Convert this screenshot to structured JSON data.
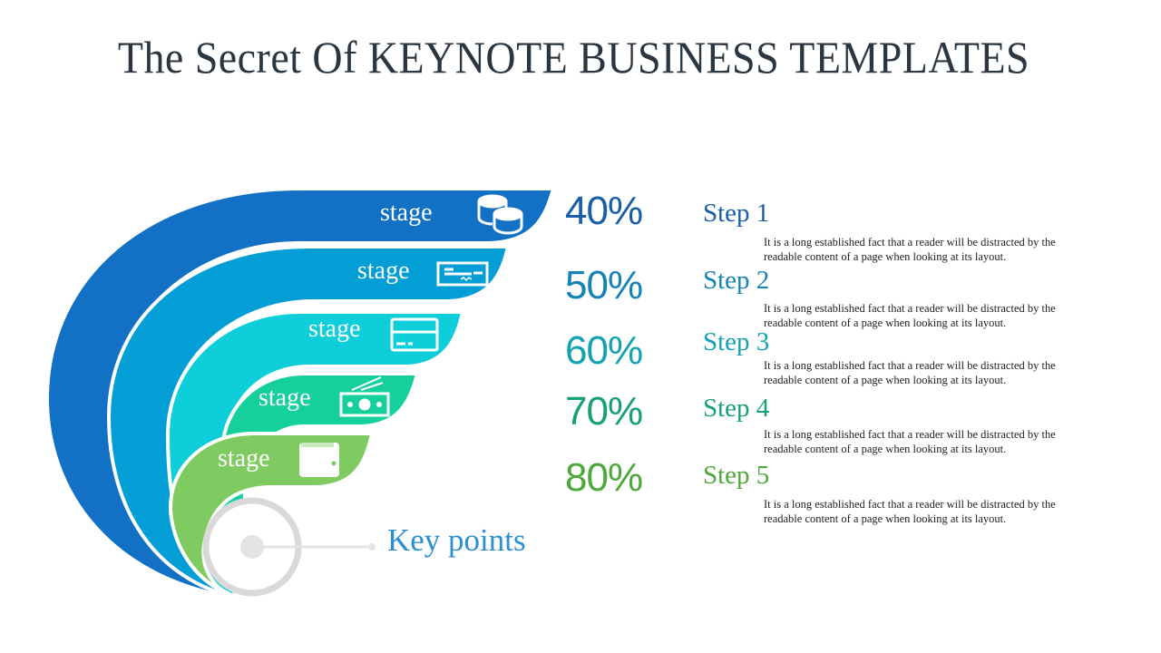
{
  "title": "The Secret Of KEYNOTE BUSINESS TEMPLATES",
  "stages": [
    {
      "label": "stage",
      "icon": "coins-icon",
      "percent": "40%",
      "step": "Step 1",
      "color": "#1271c4",
      "pct_color": "#1a5ea8",
      "step_color": "#1a5ea8",
      "description_line1": "It is a long established fact that a reader will be distracted by the",
      "description_line2": "readable content of a page when looking  at its layout."
    },
    {
      "label": "stage",
      "icon": "check-icon",
      "percent": "50%",
      "step": "Step 2",
      "color": "#049ed6",
      "pct_color": "#1583b5",
      "step_color": "#1583b5",
      "description_line1": "It is a long established fact that a reader will be distracted by the",
      "description_line2": "readable content of a page when looking  at its layout."
    },
    {
      "label": "stage",
      "icon": "credit-card-icon",
      "percent": "60%",
      "step": "Step 3",
      "color": "#0ecfd9",
      "pct_color": "#13a3b0",
      "step_color": "#13a3b0",
      "description_line1": "It is a long established fact that a reader will be distracted by the",
      "description_line2": "readable content of a page when looking  at its layout."
    },
    {
      "label": "stage",
      "icon": "cash-icon",
      "percent": "70%",
      "step": "Step 4",
      "color": "#15d09c",
      "pct_color": "#16a07a",
      "step_color": "#16a07a",
      "description_line1": "It is a long established fact that a reader will be distracted by the",
      "description_line2": "readable content of a page when looking  at its layout."
    },
    {
      "label": "stage",
      "icon": "wallet-icon",
      "percent": "80%",
      "step": "Step 5",
      "color": "#7fcb62",
      "pct_color": "#4ea83a",
      "step_color": "#4ea83a",
      "description_line1": "It is a long established fact that a reader will be distracted by the",
      "description_line2": "readable content of a page when looking  at its layout."
    }
  ],
  "key_points": "Key points",
  "colors": {
    "title": "#2b3640",
    "key_points": "#2b8fd0",
    "ring": "#d9d9d9"
  }
}
